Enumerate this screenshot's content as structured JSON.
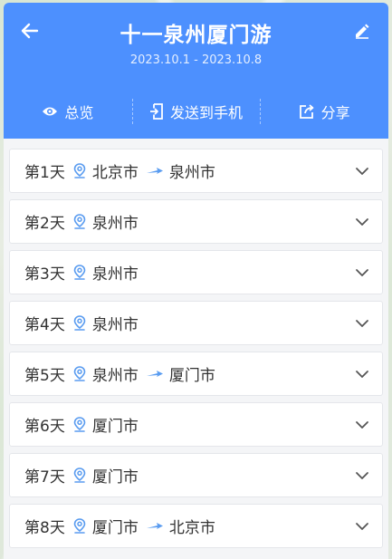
{
  "header": {
    "title": "十一泉州厦门游",
    "dates": "2023.10.1 - 2023.10.8"
  },
  "actions": [
    {
      "label": "总览",
      "icon": "eye-icon"
    },
    {
      "label": "发送到手机",
      "icon": "send-to-phone-icon"
    },
    {
      "label": "分享",
      "icon": "share-icon"
    }
  ],
  "days": [
    {
      "label": "第1天",
      "from": "北京市",
      "to": "泉州市"
    },
    {
      "label": "第2天",
      "from": "泉州市",
      "to": ""
    },
    {
      "label": "第3天",
      "from": "泉州市",
      "to": ""
    },
    {
      "label": "第4天",
      "from": "泉州市",
      "to": ""
    },
    {
      "label": "第5天",
      "from": "泉州市",
      "to": "厦门市"
    },
    {
      "label": "第6天",
      "from": "厦门市",
      "to": ""
    },
    {
      "label": "第7天",
      "from": "厦门市",
      "to": ""
    },
    {
      "label": "第8天",
      "from": "厦门市",
      "to": "北京市"
    }
  ],
  "colors": {
    "accent": "#4d90fe",
    "pin": "#5a9cf0"
  }
}
